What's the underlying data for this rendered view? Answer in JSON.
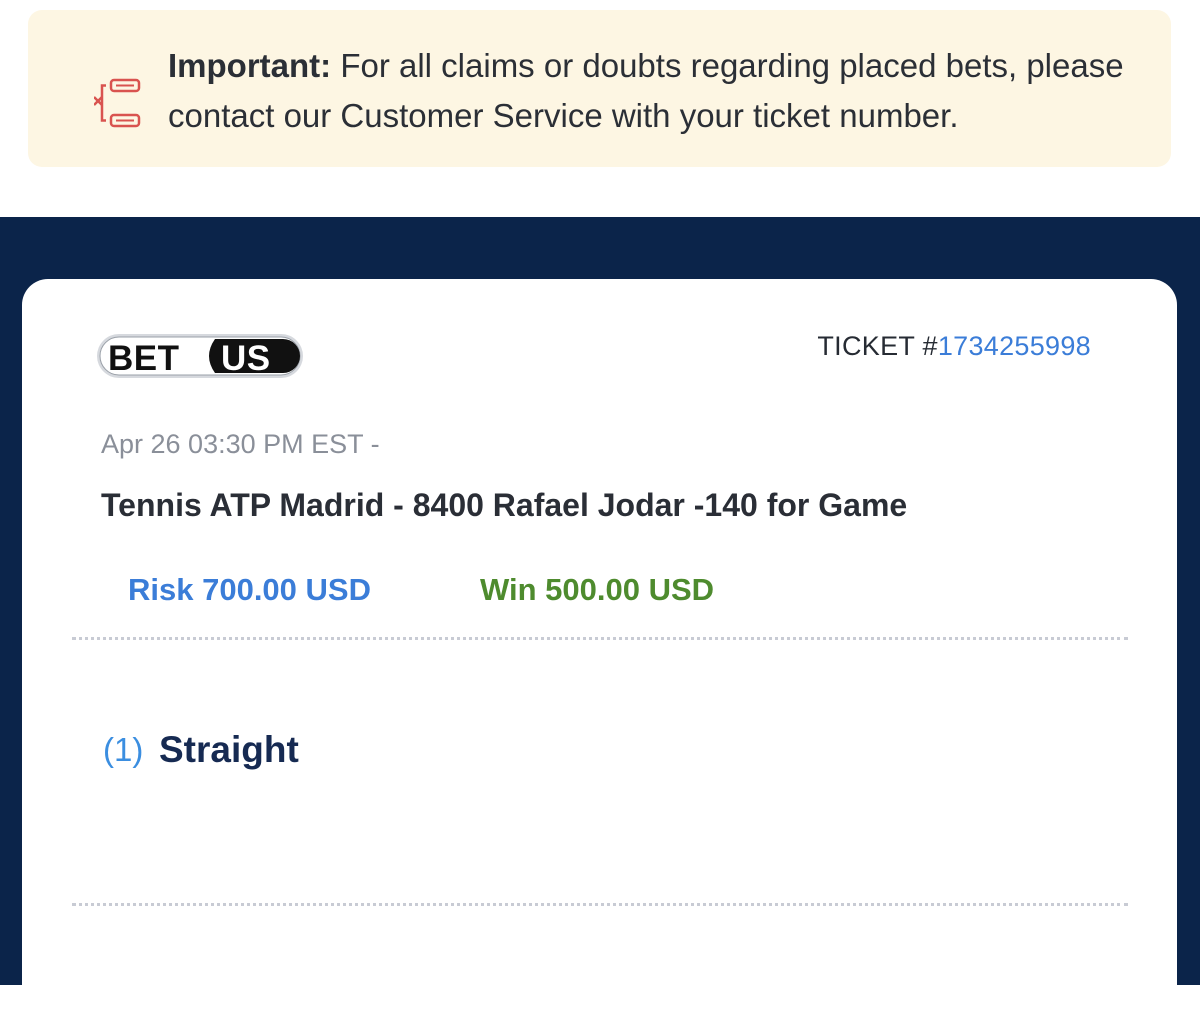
{
  "notice": {
    "icon": "bracket-icon",
    "label": "Important:",
    "message": " For all claims or doubts regarding placed bets, please contact our Customer Service with your ticket number."
  },
  "ticket": {
    "logo_text": "BETUS",
    "ticket_label": "TICKET #",
    "ticket_number": "1734255998",
    "datetime": "Apr 26 03:30 PM EST  -",
    "event": "Tennis ATP Madrid - 8400 Rafael Jodar -140 for Game",
    "risk": "Risk 700.00 USD",
    "win": "Win 500.00 USD",
    "bet_count": "(1)",
    "bet_type": "Straight"
  },
  "colors": {
    "banner_bg": "#fdf6e3",
    "dark_bg": "#0b244a",
    "accent_blue": "#3b7dd8",
    "win_green": "#4e8b2e",
    "icon_red": "#d9534f"
  }
}
